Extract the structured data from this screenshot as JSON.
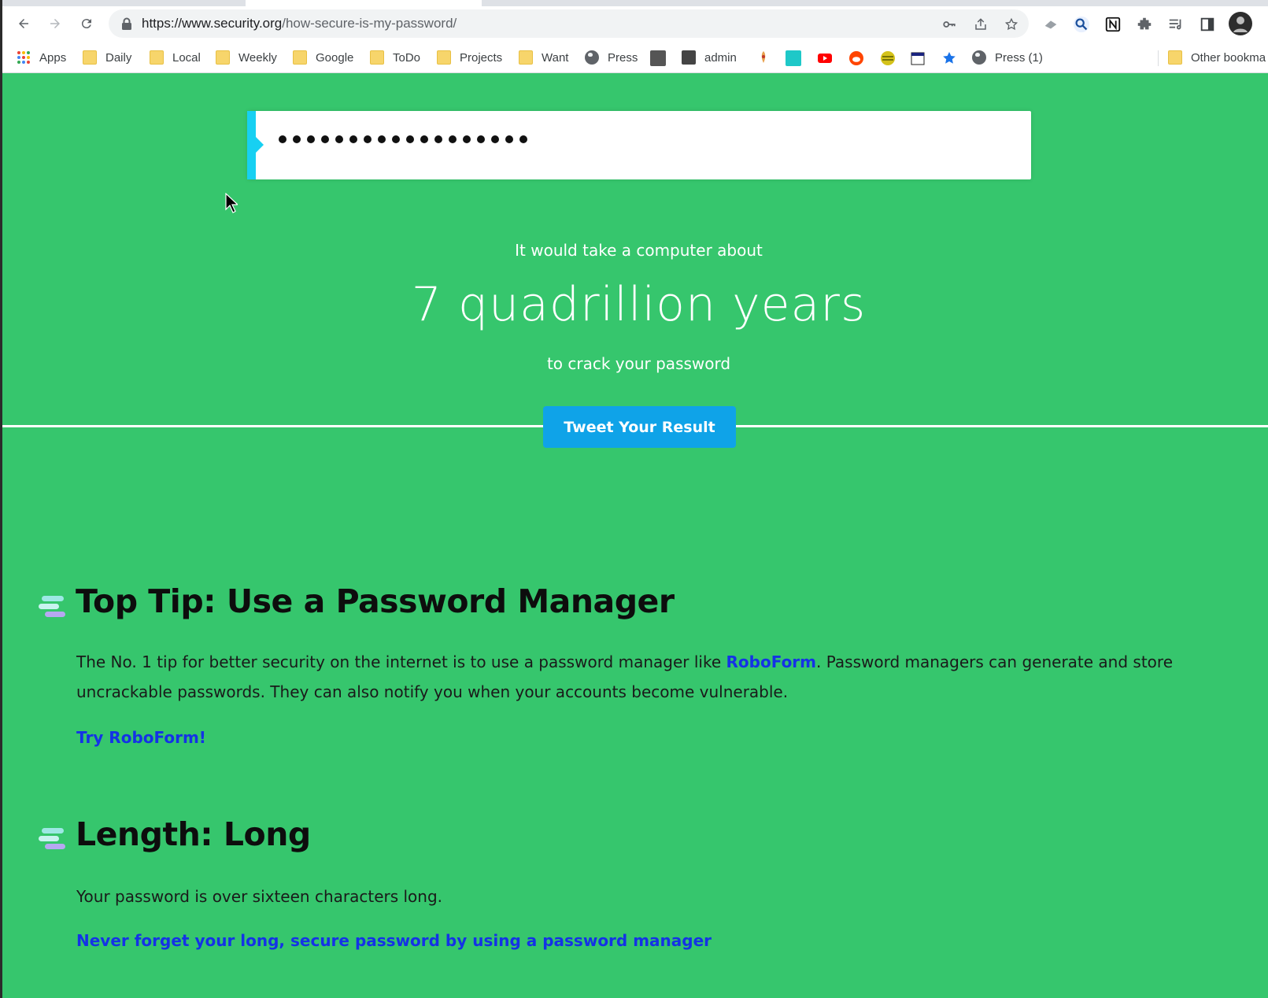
{
  "browser": {
    "url_host": "https://www.security.org",
    "url_path": "/how-secure-is-my-password/",
    "bookmarks": [
      {
        "label": "Apps",
        "icon": "apps-grid-icon"
      },
      {
        "label": "Daily",
        "icon": "folder-icon"
      },
      {
        "label": "Local",
        "icon": "folder-icon"
      },
      {
        "label": "Weekly",
        "icon": "folder-icon"
      },
      {
        "label": "Google",
        "icon": "folder-icon"
      },
      {
        "label": "ToDo",
        "icon": "folder-icon"
      },
      {
        "label": "Projects",
        "icon": "folder-icon"
      },
      {
        "label": "Want",
        "icon": "folder-icon"
      },
      {
        "label": "Press",
        "icon": "globe-icon"
      },
      {
        "label": "admin",
        "icon": "site-favicon-icon"
      },
      {
        "label": "Press (1)",
        "icon": "globe-icon"
      },
      {
        "label": "Other bookma",
        "icon": "folder-icon"
      }
    ]
  },
  "password": {
    "masked_value": "•••••••••••••••••",
    "dot_count": 18
  },
  "result": {
    "pre": "It would take a computer about",
    "time": "7 quadrillion years",
    "post": "to crack your password",
    "tweet_label": "Tweet Your Result"
  },
  "sections": {
    "tip": {
      "title": "Top Tip: Use a Password Manager",
      "body_before": "The No. 1 tip for better security on the internet is to use a password manager like ",
      "body_link": "RoboForm",
      "body_after": ". Password managers can generate and store uncrackable passwords. They can also notify you when your accounts become vulnerable.",
      "cta": "Try RoboForm!"
    },
    "length": {
      "title": "Length: Long",
      "body": "Your password is over sixteen characters long.",
      "cta": "Never forget your long, secure password by using a password manager"
    }
  },
  "colors": {
    "page_bg": "#36c66d",
    "accent_cyan": "#17d0f2",
    "tweet_blue": "#0fa3e8",
    "link_blue": "#1432e6"
  }
}
